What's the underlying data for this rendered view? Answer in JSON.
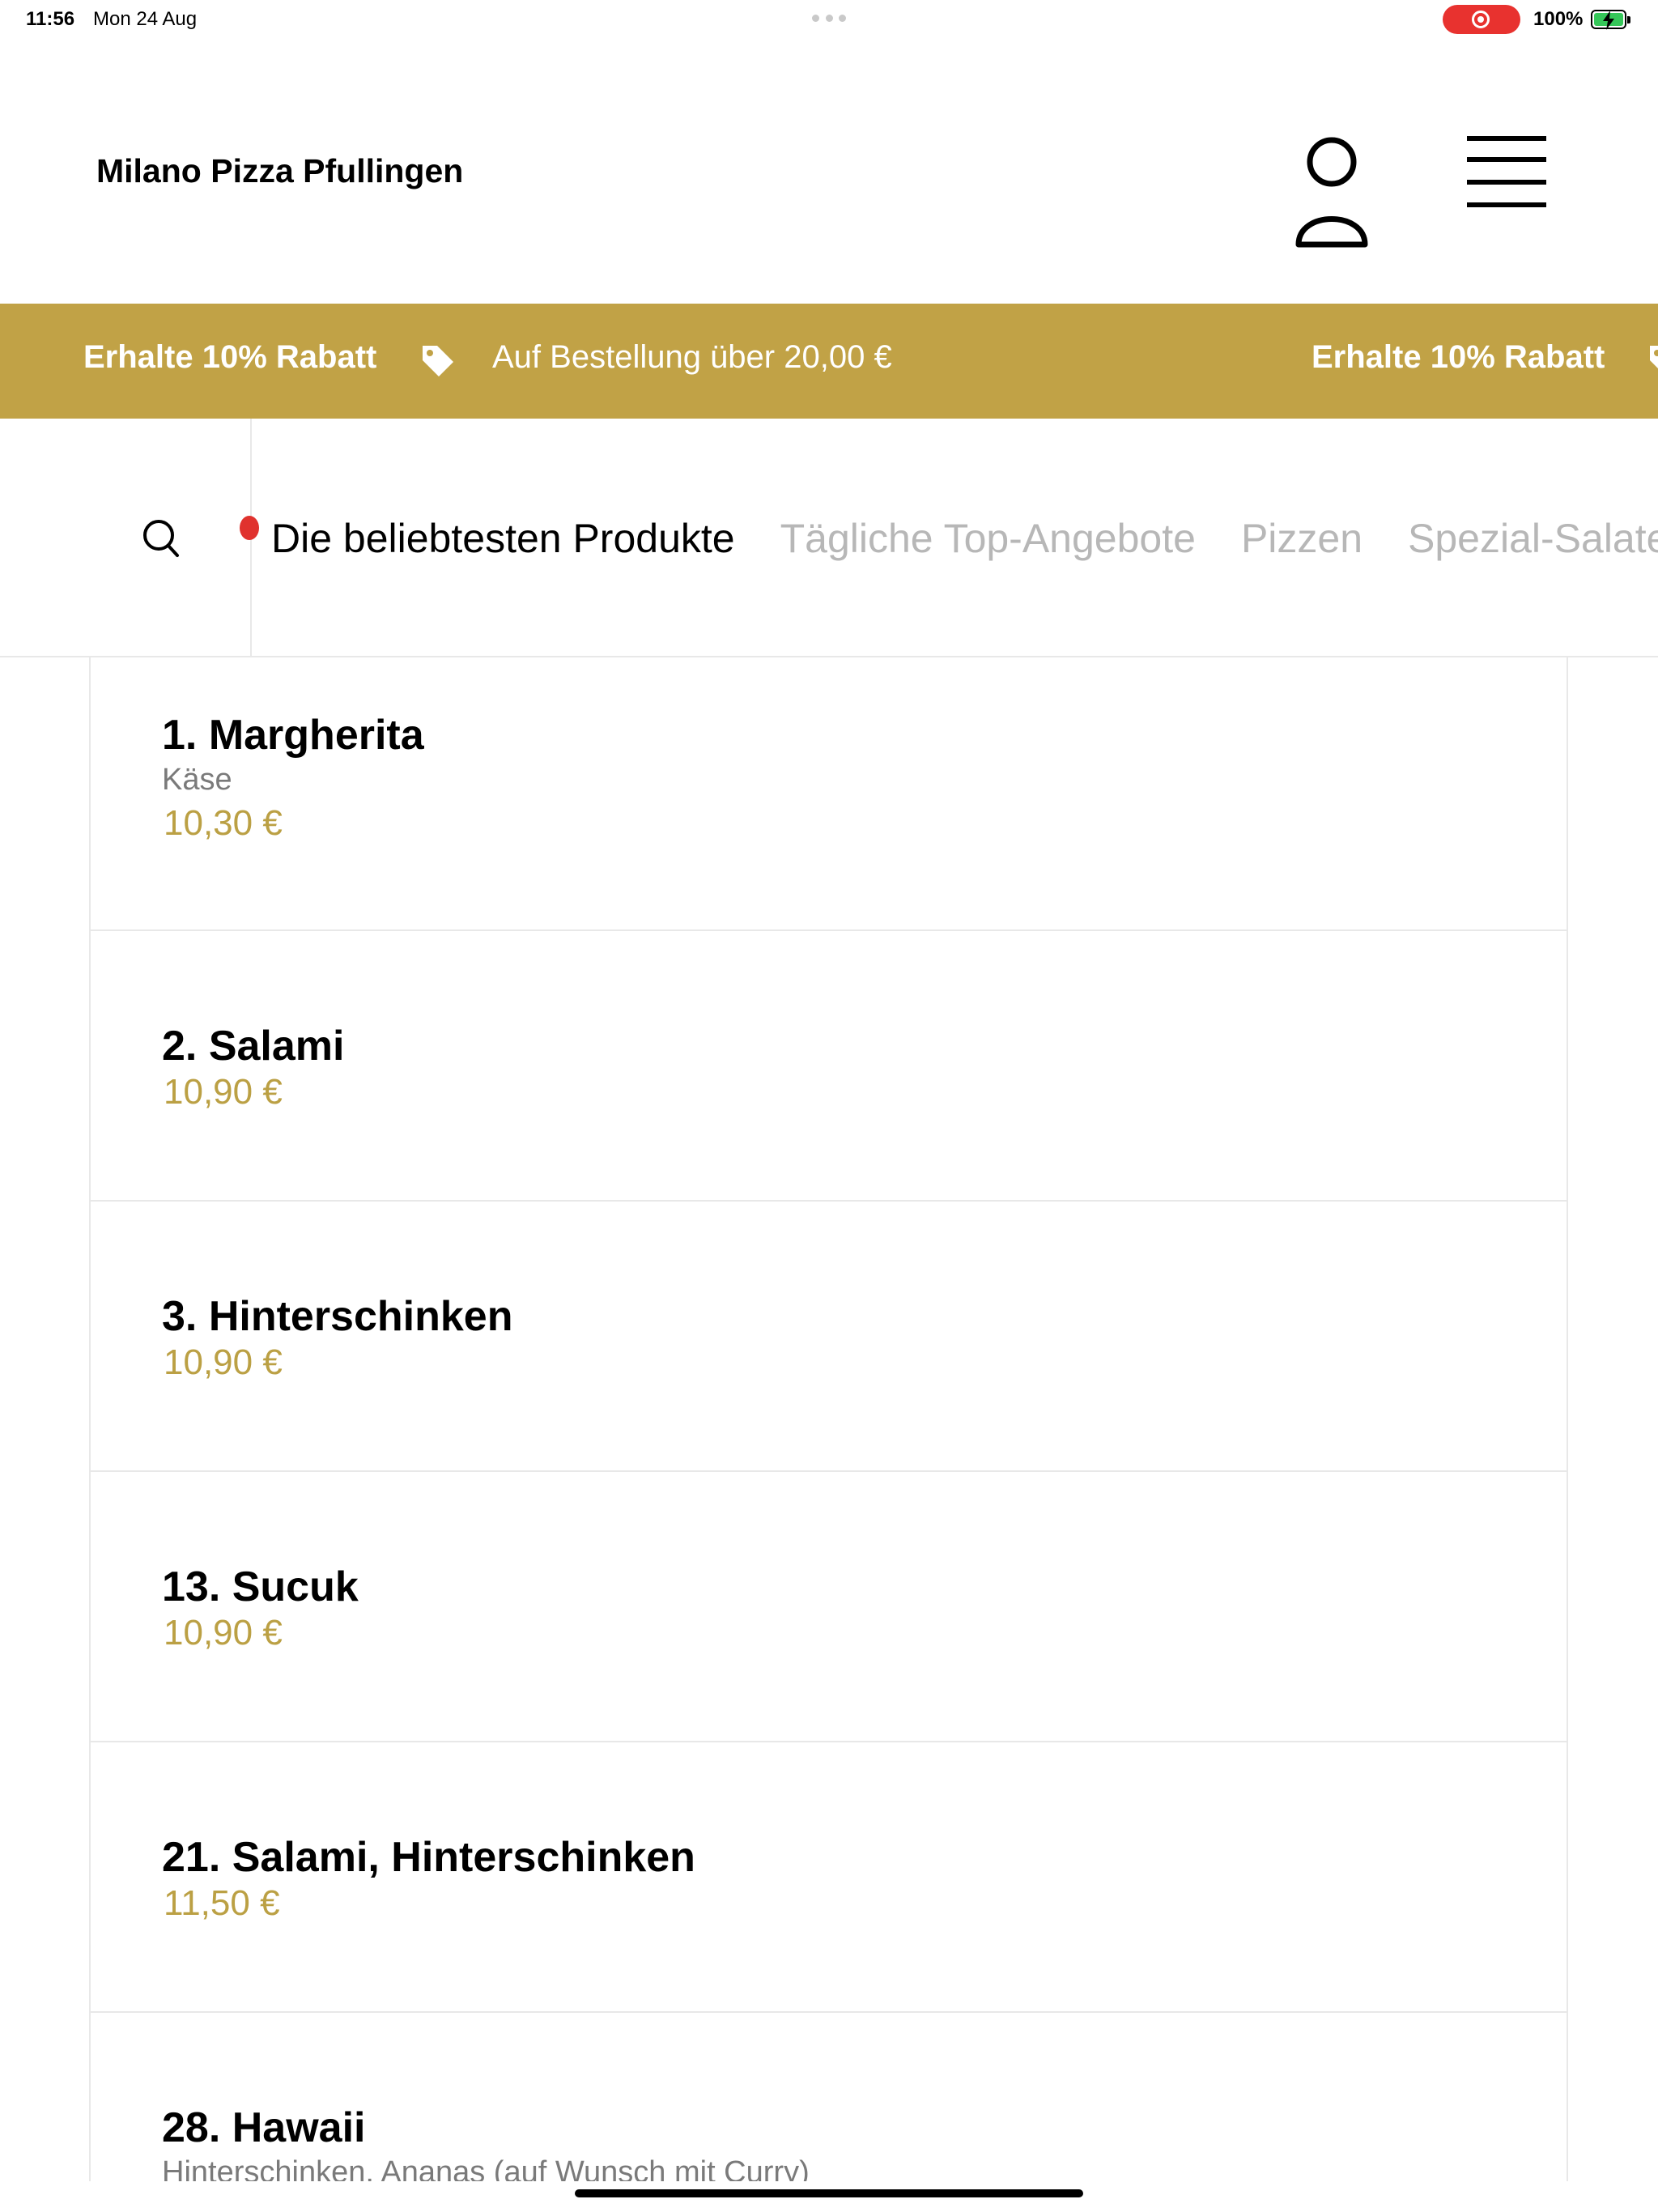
{
  "status_bar": {
    "time": "11:56",
    "date": "Mon 24 Aug",
    "battery_percent": "100%",
    "battery_level": 1.0
  },
  "header": {
    "restaurant_name": "Milano Pizza Pfullingen",
    "icons": [
      "user-icon",
      "hamburger-menu-icon"
    ]
  },
  "promo": {
    "discount": "Erhalte 10% Rabatt",
    "condition": "Auf Bestellung über 20,00 €",
    "discount_repeat": "Erhalte 10% Rabatt",
    "icon": "price-tag-icon"
  },
  "categories": {
    "search_icon": "search-icon",
    "tabs": [
      {
        "label": "Die beliebtesten Produkte",
        "active": true
      },
      {
        "label": "Tägliche Top-Angebote",
        "active": false
      },
      {
        "label": "Pizzen",
        "active": false
      },
      {
        "label": "Spezial-Salate",
        "active": false
      }
    ]
  },
  "products": [
    {
      "name": "1. Margherita",
      "description": "Käse",
      "price": "10,30 €"
    },
    {
      "name": "2. Salami",
      "description": "",
      "price": "10,90 €"
    },
    {
      "name": "3. Hinterschinken",
      "description": "",
      "price": "10,90 €"
    },
    {
      "name": "13. Sucuk",
      "description": "",
      "price": "10,90 €"
    },
    {
      "name": "21. Salami, Hinterschinken",
      "description": "",
      "price": "11,50 €"
    },
    {
      "name": "28. Hawaii",
      "description": "Hinterschinken, Ananas (auf Wunsch mit Curry)",
      "price": ""
    }
  ],
  "colors": {
    "brand_gold": "#c1a246",
    "price_gold": "#bba044",
    "recording_red": "#e8322f",
    "active_dot_red": "#e0322e"
  }
}
